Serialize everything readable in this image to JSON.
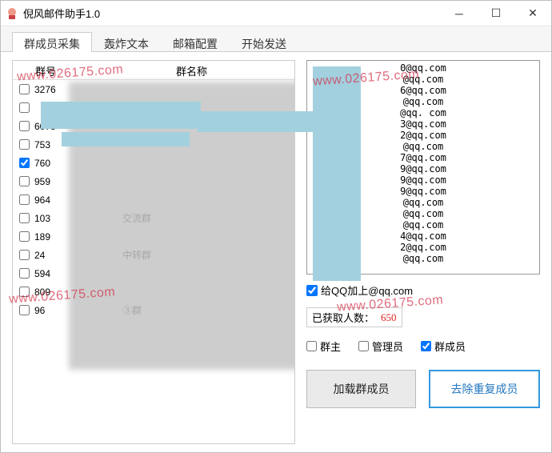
{
  "window": {
    "title": "倪风邮件助手1.0"
  },
  "tabs": [
    {
      "label": "群成员采集",
      "active": true
    },
    {
      "label": "轰炸文本",
      "active": false
    },
    {
      "label": "邮箱配置",
      "active": false
    },
    {
      "label": "开始发送",
      "active": false
    }
  ],
  "grid": {
    "headers": {
      "id": "群号",
      "name": "群名称"
    },
    "rows": [
      {
        "gid": "3276",
        "name": "",
        "checked": false
      },
      {
        "gid": "",
        "name": "",
        "checked": false
      },
      {
        "gid": "6078",
        "name": "",
        "checked": false
      },
      {
        "gid": "753",
        "name": "",
        "checked": false
      },
      {
        "gid": "760",
        "name": "",
        "checked": true
      },
      {
        "gid": "959",
        "name": "",
        "checked": false
      },
      {
        "gid": "964",
        "name": "",
        "checked": false
      },
      {
        "gid": "103",
        "name": "交流群",
        "checked": false
      },
      {
        "gid": "189",
        "name": "",
        "checked": false
      },
      {
        "gid": "24",
        "name": "中转群",
        "checked": false
      },
      {
        "gid": "594",
        "name": "",
        "checked": false
      },
      {
        "gid": "809",
        "name": "",
        "checked": false
      },
      {
        "gid": "96",
        "name": "③群",
        "checked": false
      }
    ]
  },
  "emails": [
    "0@qq.com",
    "@qq.com",
    "6@qq.com",
    "@qq.com",
    "@qq. com",
    "3@qq.com",
    "2@qq.com",
    "@qq.com",
    "7@qq.com",
    "9@qq.com",
    "9@qq.com",
    "9@qq.com",
    "@qq.com",
    "@qq.com",
    "@qq.com",
    "4@qq.com",
    "2@qq.com",
    "@qq.com"
  ],
  "options": {
    "append_domain": {
      "checked": true,
      "label": "给QQ加上@qq.com"
    },
    "count_label": "已获取人数：",
    "count_value": "650",
    "roles": {
      "owner": {
        "label": "群主",
        "checked": false
      },
      "admin": {
        "label": "管理员",
        "checked": false
      },
      "member": {
        "label": "群成员",
        "checked": true
      }
    }
  },
  "buttons": {
    "load": "加载群成员",
    "dedup": "去除重复成员"
  },
  "watermark": "www.026175.com"
}
